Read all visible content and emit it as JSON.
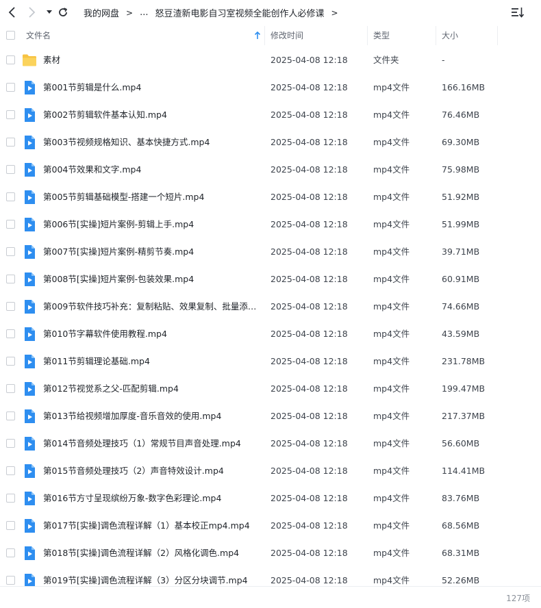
{
  "nav": {
    "back_icon": "chevron-left-icon",
    "forward_icon": "chevron-right-icon",
    "history_icon": "caret-down-icon",
    "refresh_icon": "refresh-icon"
  },
  "breadcrumb": {
    "root": "我的网盘",
    "separator": ">",
    "ellipsis": "...",
    "current": "怒豆渣新电影自习室视频全能创作人必修课"
  },
  "toolbar": {
    "sort_icon": "sort-list-icon"
  },
  "columns": {
    "name": "文件名",
    "modified": "修改时间",
    "type": "类型",
    "size": "大小"
  },
  "sort": {
    "column": "name",
    "direction": "ascending",
    "icon": "arrow-up-icon"
  },
  "accent_color": "#2e8ef0",
  "folder_color": "#f7c343",
  "files": [
    {
      "name": "素材",
      "modified": "2025-04-08 12:18",
      "type": "文件夹",
      "size": "-",
      "kind": "folder"
    },
    {
      "name": "第001节剪辑是什么.mp4",
      "modified": "2025-04-08 12:18",
      "type": "mp4文件",
      "size": "166.16MB",
      "kind": "video"
    },
    {
      "name": "第002节剪辑软件基本认知.mp4",
      "modified": "2025-04-08 12:18",
      "type": "mp4文件",
      "size": "76.46MB",
      "kind": "video"
    },
    {
      "name": "第003节视频规格知识、基本快捷方式.mp4",
      "modified": "2025-04-08 12:18",
      "type": "mp4文件",
      "size": "69.30MB",
      "kind": "video"
    },
    {
      "name": "第004节效果和文字.mp4",
      "modified": "2025-04-08 12:18",
      "type": "mp4文件",
      "size": "75.98MB",
      "kind": "video"
    },
    {
      "name": "第005节剪辑基础模型-搭建一个短片.mp4",
      "modified": "2025-04-08 12:18",
      "type": "mp4文件",
      "size": "51.92MB",
      "kind": "video"
    },
    {
      "name": "第006节[实操]短片案例-剪辑上手.mp4",
      "modified": "2025-04-08 12:18",
      "type": "mp4文件",
      "size": "51.99MB",
      "kind": "video"
    },
    {
      "name": "第007节[实操]短片案例-精剪节奏.mp4",
      "modified": "2025-04-08 12:18",
      "type": "mp4文件",
      "size": "39.71MB",
      "kind": "video"
    },
    {
      "name": "第008节[实操]短片案例-包装效果.mp4",
      "modified": "2025-04-08 12:18",
      "type": "mp4文件",
      "size": "60.91MB",
      "kind": "video"
    },
    {
      "name": "第009节软件技巧补充：复制粘贴、效果复制、批量添加...",
      "modified": "2025-04-08 12:18",
      "type": "mp4文件",
      "size": "74.66MB",
      "kind": "video"
    },
    {
      "name": "第010节字幕软件使用教程.mp4",
      "modified": "2025-04-08 12:18",
      "type": "mp4文件",
      "size": "43.59MB",
      "kind": "video"
    },
    {
      "name": "第011节剪辑理论基础.mp4",
      "modified": "2025-04-08 12:18",
      "type": "mp4文件",
      "size": "231.78MB",
      "kind": "video"
    },
    {
      "name": "第012节视觉系之父-匹配剪辑.mp4",
      "modified": "2025-04-08 12:18",
      "type": "mp4文件",
      "size": "199.47MB",
      "kind": "video"
    },
    {
      "name": "第013节给视频增加厚度-音乐音效的使用.mp4",
      "modified": "2025-04-08 12:18",
      "type": "mp4文件",
      "size": "217.37MB",
      "kind": "video"
    },
    {
      "name": "第014节音频处理技巧（1）常规节目声音处理.mp4",
      "modified": "2025-04-08 12:18",
      "type": "mp4文件",
      "size": "56.60MB",
      "kind": "video"
    },
    {
      "name": "第015节音频处理技巧（2）声音特效设计.mp4",
      "modified": "2025-04-08 12:18",
      "type": "mp4文件",
      "size": "114.41MB",
      "kind": "video"
    },
    {
      "name": "第016节方寸呈现缤纷万象-数字色彩理论.mp4",
      "modified": "2025-04-08 12:18",
      "type": "mp4文件",
      "size": "83.76MB",
      "kind": "video"
    },
    {
      "name": "第017节[实操]调色流程详解（1）基本校正mp4.mp4",
      "modified": "2025-04-08 12:18",
      "type": "mp4文件",
      "size": "68.56MB",
      "kind": "video"
    },
    {
      "name": "第018节[实操]调色流程详解（2）风格化调色.mp4",
      "modified": "2025-04-08 12:18",
      "type": "mp4文件",
      "size": "68.31MB",
      "kind": "video"
    },
    {
      "name": "第019节[实操]调色流程详解（3）分区分块调节.mp4",
      "modified": "2025-04-08 12:18",
      "type": "mp4文件",
      "size": "52.26MB",
      "kind": "video"
    }
  ],
  "footer": {
    "item_count": "127项"
  }
}
